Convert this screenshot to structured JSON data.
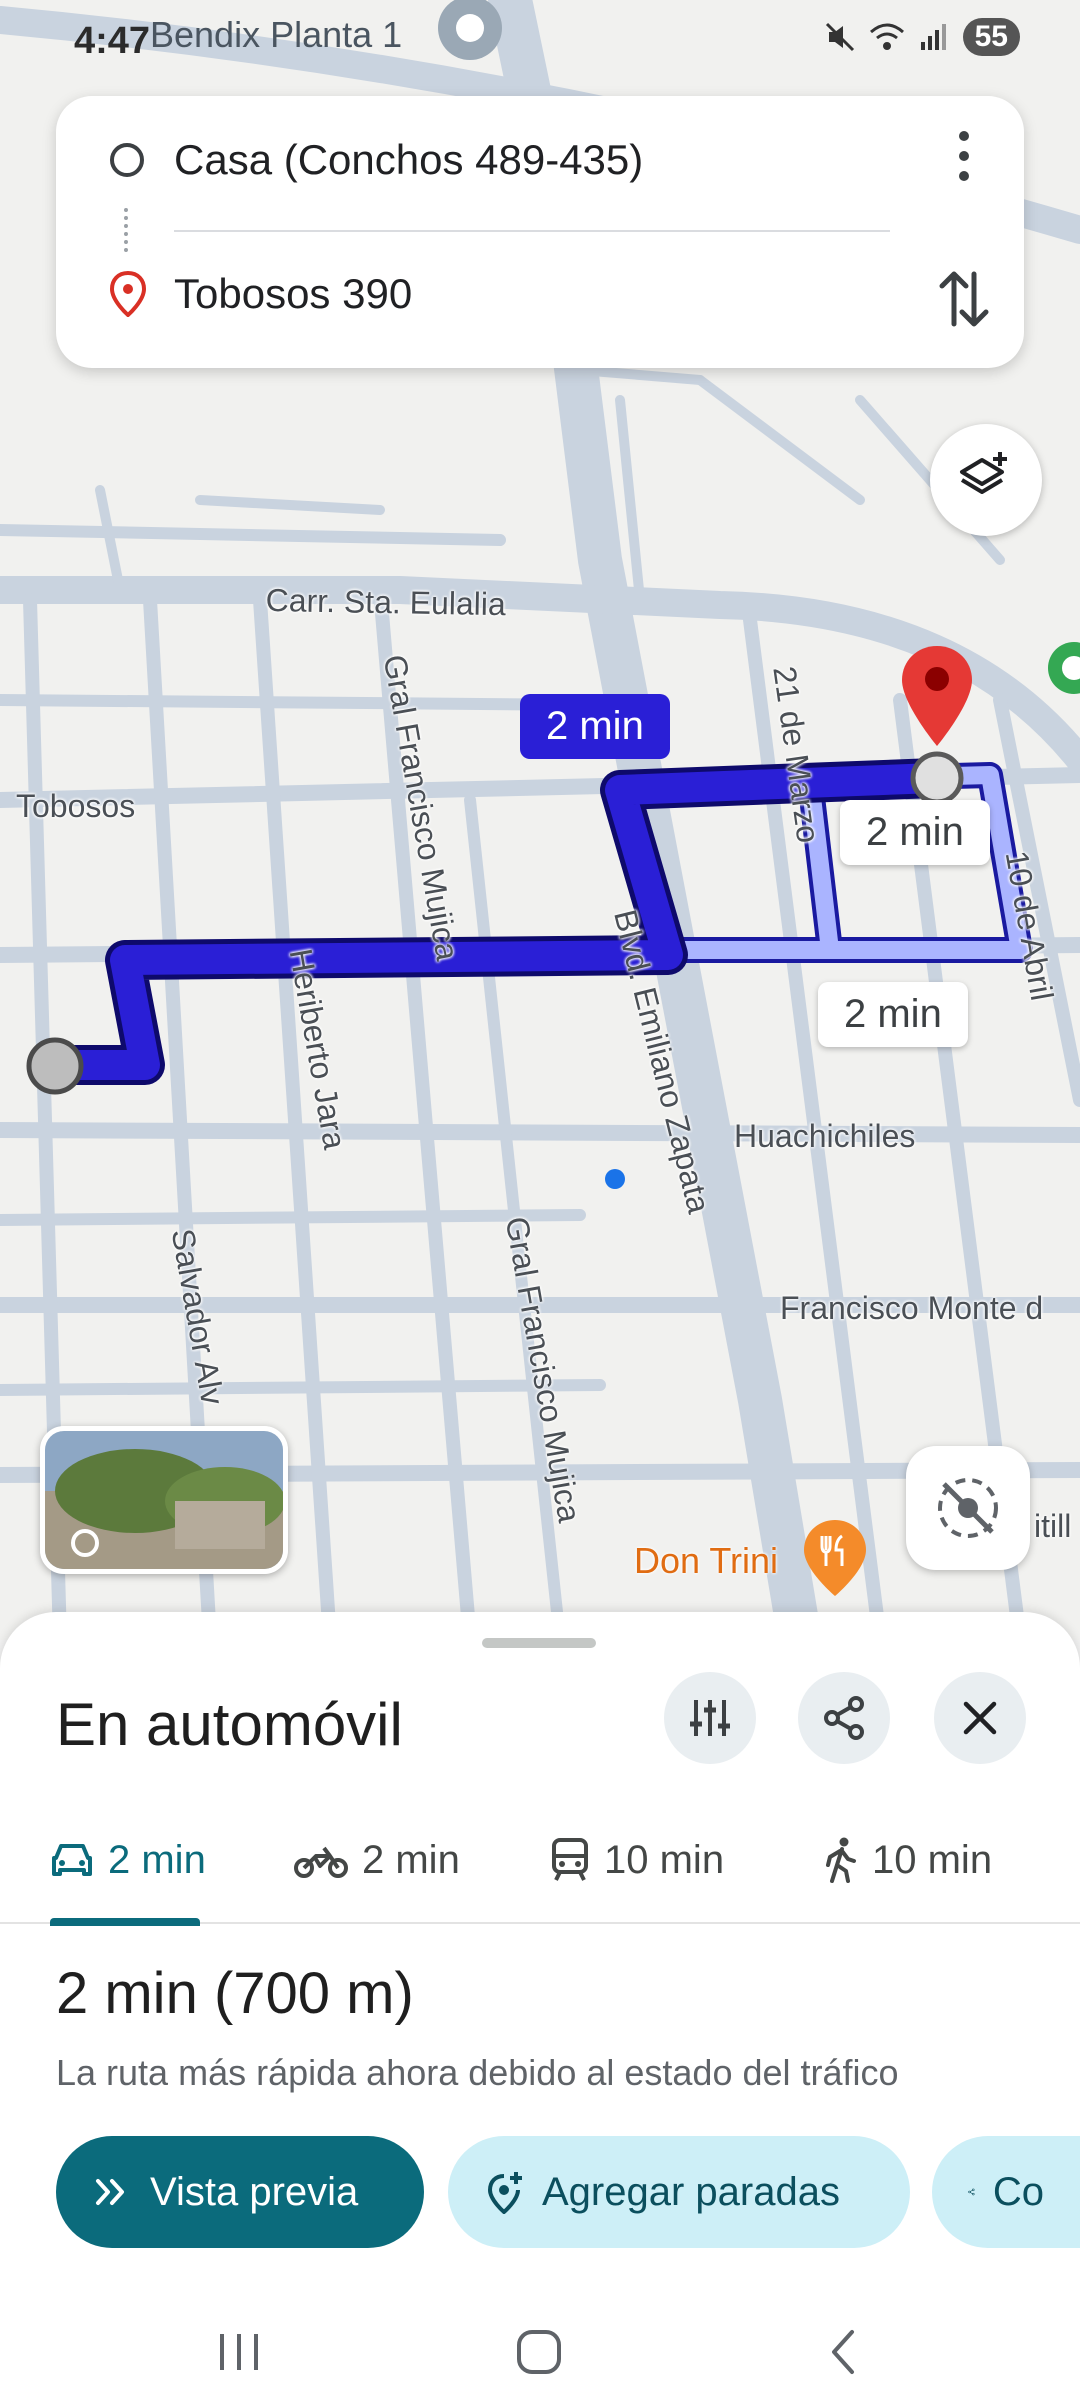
{
  "status_bar": {
    "time": "4:47",
    "notification_icons": "C◎≋•",
    "overlay_place": "Bendix Planta 1",
    "battery": "55"
  },
  "route_card": {
    "origin": "Casa (Conchos 489-435)",
    "destination": "Tobosos 390"
  },
  "map": {
    "street_labels": [
      "Carr. Sta. Eulalia",
      "Tobosos",
      "Gral Francisco Mujica",
      "21 de Marzo",
      "10 de Abril",
      "Heriberto Jara",
      "Blvd. Emiliano Zapata",
      "Huachichiles",
      "Francisco Monte d",
      "Salvador Alv",
      "Gral Francisco Mujica",
      "itill"
    ],
    "route_chips": {
      "primary": "2 min",
      "alt1": "2 min",
      "alt2": "2 min"
    },
    "poi": "Don Trini",
    "colors": {
      "route_primary": "#2a1fd6",
      "route_alt": "#aab4ff",
      "road": "#c9d3df",
      "accent": "#0b6b7c"
    }
  },
  "sheet": {
    "title": "En automóvil",
    "modes": [
      {
        "icon": "car-icon",
        "label": "2 min",
        "active": true
      },
      {
        "icon": "motorcycle-icon",
        "label": "2 min",
        "active": false
      },
      {
        "icon": "transit-icon",
        "label": "10 min",
        "active": false
      },
      {
        "icon": "walk-icon",
        "label": "10 min",
        "active": false
      }
    ],
    "summary": "2 min (700 m)",
    "summary_sub": "La ruta más rápida ahora debido al estado del tráfico",
    "preview_label": "Vista previa",
    "add_stops_label": "Agregar paradas",
    "share_label": "Co"
  }
}
